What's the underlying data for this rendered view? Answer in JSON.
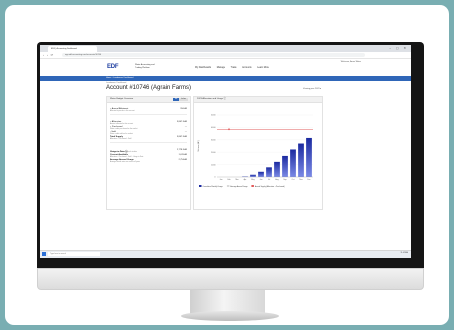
{
  "browser": {
    "tab_title": "EDF | Accounting Dashboard",
    "url": "app.edf-accounting.com/accounts/10746",
    "window_controls": "– ▢ ✕"
  },
  "site": {
    "logo_text": "EDF",
    "logo_subtitle": "Water Accounting and Trading Platform",
    "nav": [
      "My Dashboards",
      "Manage",
      "Trade",
      "Accounts",
      "Learn More"
    ],
    "user_label": "Welcome, Acme Water",
    "bluebar_text": "Home  ›  Landowner Dashboard"
  },
  "page": {
    "breadcrumb": "Landowner Dashboard",
    "account_title": "Account #10746 (Agrain Farms)",
    "viewing_label": "Viewing year 2023 ▾"
  },
  "left_panel": {
    "title": "Water Budget Overview",
    "toggle_on": "AF",
    "toggle_off": "Inches",
    "rows_a": [
      {
        "label": "+ Annual Allotment",
        "sub": "Allocated to parcels in this account",
        "value": "950 AF"
      }
    ],
    "rows_b": [
      {
        "label": "+ Allocation",
        "sub": "Amount allocated to this account",
        "value": "3,847.3 AF"
      },
      {
        "label": "+ Purchased",
        "sub": "Water credits purchased on the market",
        "value": "—"
      },
      {
        "label": "- Sold",
        "sub": "Water credits sold on the market",
        "value": "—"
      },
      {
        "label": "Total Supply",
        "sub": "Allocation + Purchased – Sold",
        "value": "3,847.3 AF"
      }
    ],
    "rows_c": [
      {
        "label": "Usage to Date ⓘ",
        "sub": "Total water use across parcels to date",
        "value": "2,778.3 AF"
      },
      {
        "label": "Current Available",
        "sub": "Allocation + Purchased – Sold – Usage to Date",
        "value": "1,070 AF"
      },
      {
        "label": "Average Annual Usage",
        "sub": "Average annual water use across all years",
        "value": "2,754 AF"
      }
    ]
  },
  "right_panel": {
    "title": "2023 Allocation and Usage ⓘ"
  },
  "chart_data": {
    "type": "bar",
    "categories": [
      "Jan",
      "Feb",
      "Mar",
      "Apr",
      "May",
      "Jun",
      "Jul",
      "Aug",
      "Sep",
      "Oct",
      "Nov",
      "Dec"
    ],
    "series": [
      {
        "name": "Cumulative Monthly Usage",
        "values": [
          0,
          0,
          0,
          40,
          180,
          420,
          780,
          1220,
          1700,
          2220,
          2700,
          3150
        ]
      }
    ],
    "reference_line": {
      "name": "Annual Supply",
      "value": 3847
    },
    "ylim": [
      0,
      5000
    ],
    "yticks": [
      0,
      1000,
      2000,
      3000,
      4000,
      5000
    ],
    "ylabel": "Volume (AF)",
    "legend": [
      "Cumulative Monthly Usage",
      "Average Annual Usage",
      "Annual Supply (Allocation + Purchased)"
    ],
    "legend_position": "bottom",
    "colors": {
      "bar_top": "#1b2aa0",
      "bar_bottom": "#7b8ae6",
      "line": "#e2595a",
      "avg": "#d9d9d9"
    }
  },
  "taskbar": {
    "search_placeholder": "Type here to search",
    "tray": "11:42 AM",
    "icon_colors": [
      "#3b7ddd",
      "#f2b705",
      "#2a9d3a",
      "#0078d4",
      "#e24d2c",
      "#7a5bd6",
      "#1aa1e0",
      "#d83b01",
      "#107c10",
      "#5c2d91"
    ]
  }
}
